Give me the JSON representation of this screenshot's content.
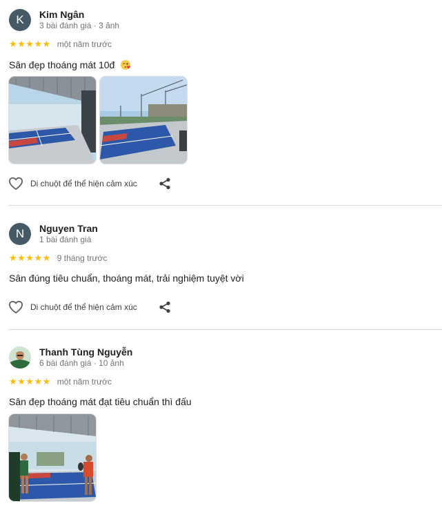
{
  "reviews": [
    {
      "avatar_letter": "K",
      "name": "Kim Ngân",
      "meta": "3 bài đánh giá · 3 ảnh",
      "stars": "★★★★★",
      "rating": 5,
      "time": "một năm trước",
      "text": "Sân đẹp thoáng mát 10đ",
      "emoji_icon": "kiss-face-icon",
      "react_label": "Di chuột để thể hiện cảm xúc"
    },
    {
      "avatar_letter": "N",
      "name": "Nguyen Tran",
      "meta": "1 bài đánh giá",
      "stars": "★★★★★",
      "rating": 5,
      "time": "9 tháng trước",
      "text": "Sân đúng tiêu chuẩn, thoáng mát, trải nghiệm tuyệt vời",
      "react_label": "Di chuột để thể hiện cảm xúc"
    },
    {
      "name": "Thanh Tùng Nguyễn",
      "meta": "6 bài đánh giá · 10 ảnh",
      "stars": "★★★★★",
      "rating": 5,
      "time": "một năm trước",
      "text": "Sân đẹp thoáng mát đạt tiêu chuẩn thì đấu"
    }
  ],
  "colors": {
    "star": "#fbbc04",
    "avatar": "#455a64",
    "court_blue": "#2d57a8",
    "court_red": "#c8473f"
  }
}
